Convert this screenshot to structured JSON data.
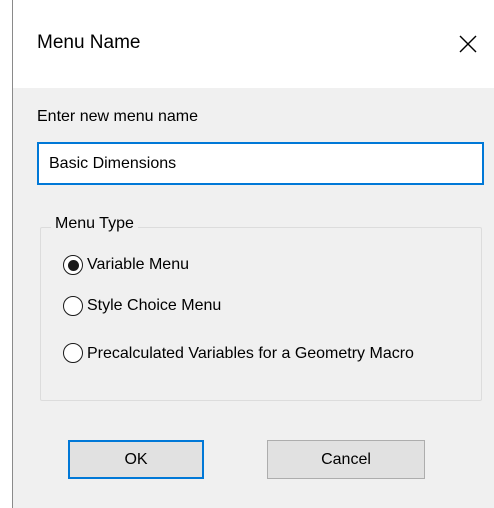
{
  "dialog": {
    "title": "Menu Name",
    "close_icon": "close-icon"
  },
  "form": {
    "prompt_label": "Enter new menu name",
    "menu_name_value": "Basic Dimensions"
  },
  "menu_type": {
    "legend": "Menu Type",
    "selected": "Variable Menu",
    "options": [
      {
        "label": "Variable Menu",
        "checked": true
      },
      {
        "label": "Style Choice Menu",
        "checked": false
      },
      {
        "label": "Precalculated Variables for a Geometry Macro",
        "checked": false
      }
    ]
  },
  "buttons": {
    "ok_label": "OK",
    "cancel_label": "Cancel"
  },
  "colors": {
    "accent": "#0078d7",
    "body_background": "#f0f0f0",
    "button_face": "#e1e1e1"
  }
}
